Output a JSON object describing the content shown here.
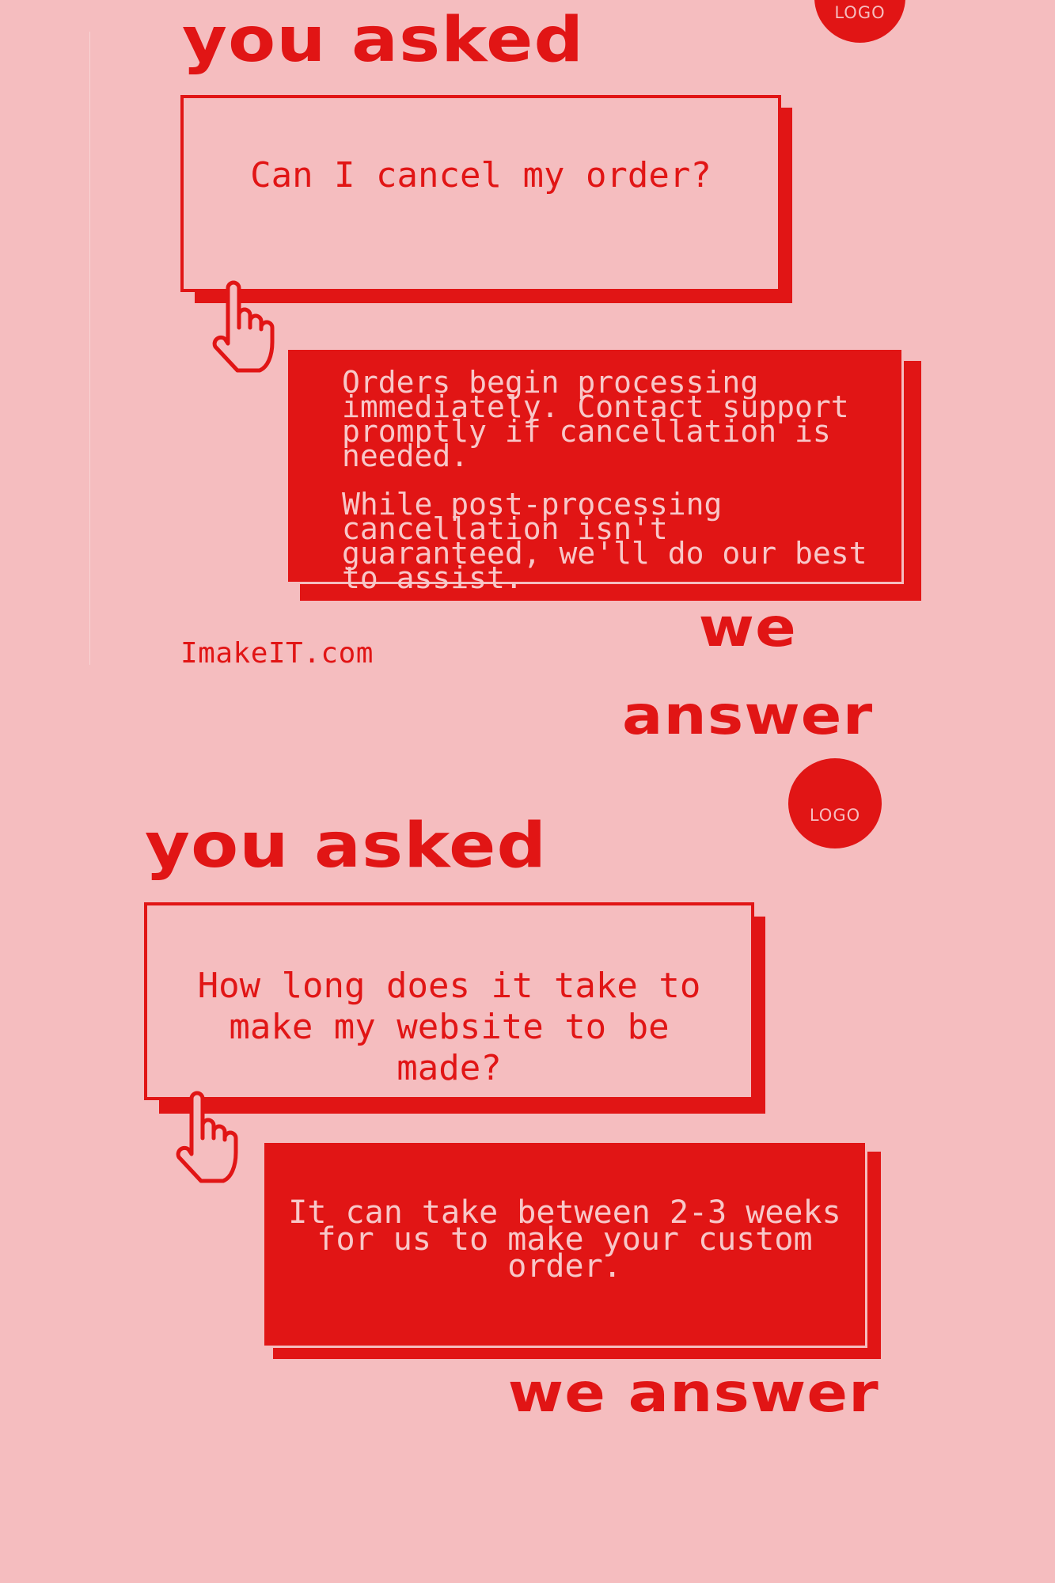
{
  "brand_colors": {
    "primary_red": "#e11515",
    "background_pink": "#f5bdbf",
    "answer_text": "#f8c7c8"
  },
  "cards": [
    {
      "logo": "LOGO",
      "heading_top": "you asked",
      "question": "Can I cancel my order?",
      "answer_paragraph_1": "Orders begin processing immediately. Contact support promptly if cancellation is needed.",
      "answer_paragraph_2": "While post-processing cancellation isn't guaranteed, we'll do our best to assist.",
      "site_url": "ImakeIT.com",
      "heading_bottom_line_1": "we",
      "heading_bottom_line_2": "answer",
      "icon": "hand-pointer-icon"
    },
    {
      "logo": "LOGO",
      "heading_top": "you asked",
      "question": "How long does it take to make my website to be made?",
      "answer_paragraph_1": "It can take between 2-3 weeks for us to make your custom order.",
      "heading_bottom": "we answer",
      "icon": "hand-pointer-icon"
    }
  ]
}
